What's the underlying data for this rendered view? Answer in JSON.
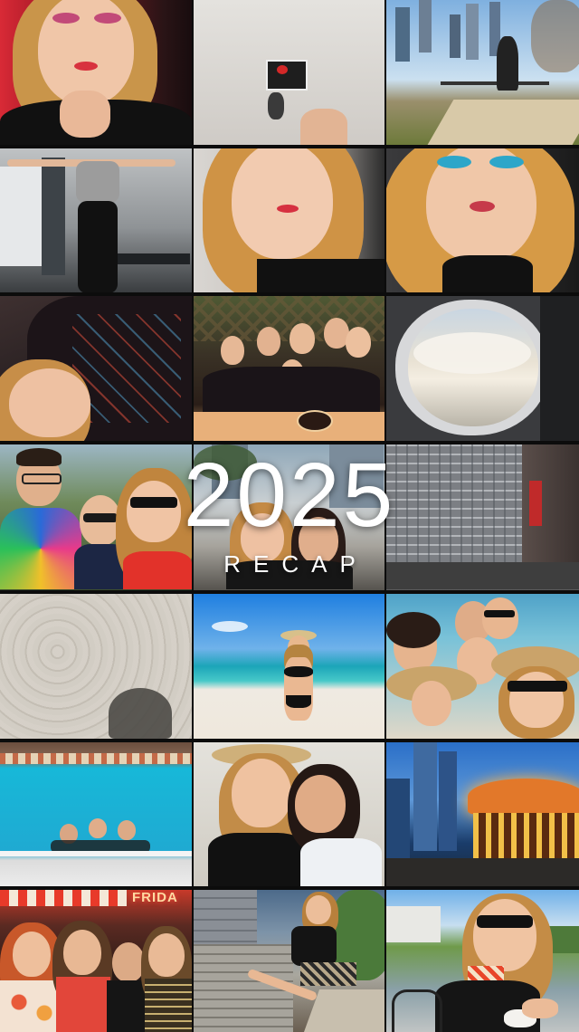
{
  "overlay": {
    "year": "2025",
    "subtitle": "RECAP"
  },
  "signage": {
    "restaurant_sign": "FRIDA"
  },
  "tiles": [
    {
      "id": 1,
      "scene": "selfie-pink-makeup"
    },
    {
      "id": 2,
      "scene": "wall-outlet-keys"
    },
    {
      "id": 3,
      "scene": "park-city-skyline"
    },
    {
      "id": 4,
      "scene": "gym-stretch"
    },
    {
      "id": 5,
      "scene": "selfie-blonde"
    },
    {
      "id": 6,
      "scene": "selfie-blue-makeup"
    },
    {
      "id": 7,
      "scene": "lying-selfie"
    },
    {
      "id": 8,
      "scene": "friends-dinner"
    },
    {
      "id": 9,
      "scene": "airplane-window"
    },
    {
      "id": 10,
      "scene": "friends-outdoors"
    },
    {
      "id": 11,
      "scene": "city-plaza-selfie"
    },
    {
      "id": 12,
      "scene": "downtown-buildings"
    },
    {
      "id": 13,
      "scene": "beach-sand-shadow"
    },
    {
      "id": 14,
      "scene": "beach-swimwear"
    },
    {
      "id": 15,
      "scene": "beach-group-selfie"
    },
    {
      "id": 16,
      "scene": "swimming-pool"
    },
    {
      "id": 17,
      "scene": "beach-two-friends"
    },
    {
      "id": 18,
      "scene": "carousel-skyline"
    },
    {
      "id": 19,
      "scene": "restaurant-friends"
    },
    {
      "id": 20,
      "scene": "boardwalk-sitting"
    },
    {
      "id": 21,
      "scene": "cafe-sunglasses"
    }
  ]
}
